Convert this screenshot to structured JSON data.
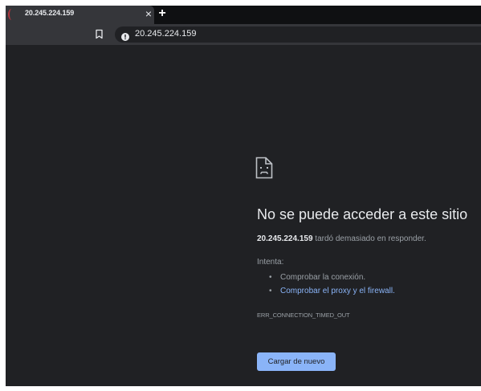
{
  "tab": {
    "title": "20.245.224.159",
    "close_glyph": "×",
    "new_tab_glyph": "+",
    "favicon": "crescent-icon"
  },
  "toolbar": {
    "bookmark_icon": "bookmark-icon",
    "security_icon": "info-icon",
    "url": "20.245.224.159"
  },
  "error_page": {
    "icon": "sad-document-icon",
    "headline": "No se puede acceder a este sitio",
    "host": "20.245.224.159",
    "message": " tardó demasiado en responder.",
    "try_label": "Intenta:",
    "suggestions": [
      {
        "text": "Comprobar la conexión.",
        "is_link": false
      },
      {
        "text": "Comprobar el proxy y el firewall.",
        "is_link": true
      }
    ],
    "error_code": "ERR_CONNECTION_TIMED_OUT",
    "reload_label": "Cargar de nuevo"
  },
  "colors": {
    "page_bg": "#202124",
    "toolbar_bg": "#35363a",
    "accent": "#8ab4f8",
    "text_primary": "#e8eaed",
    "text_secondary": "#9aa0a6"
  }
}
